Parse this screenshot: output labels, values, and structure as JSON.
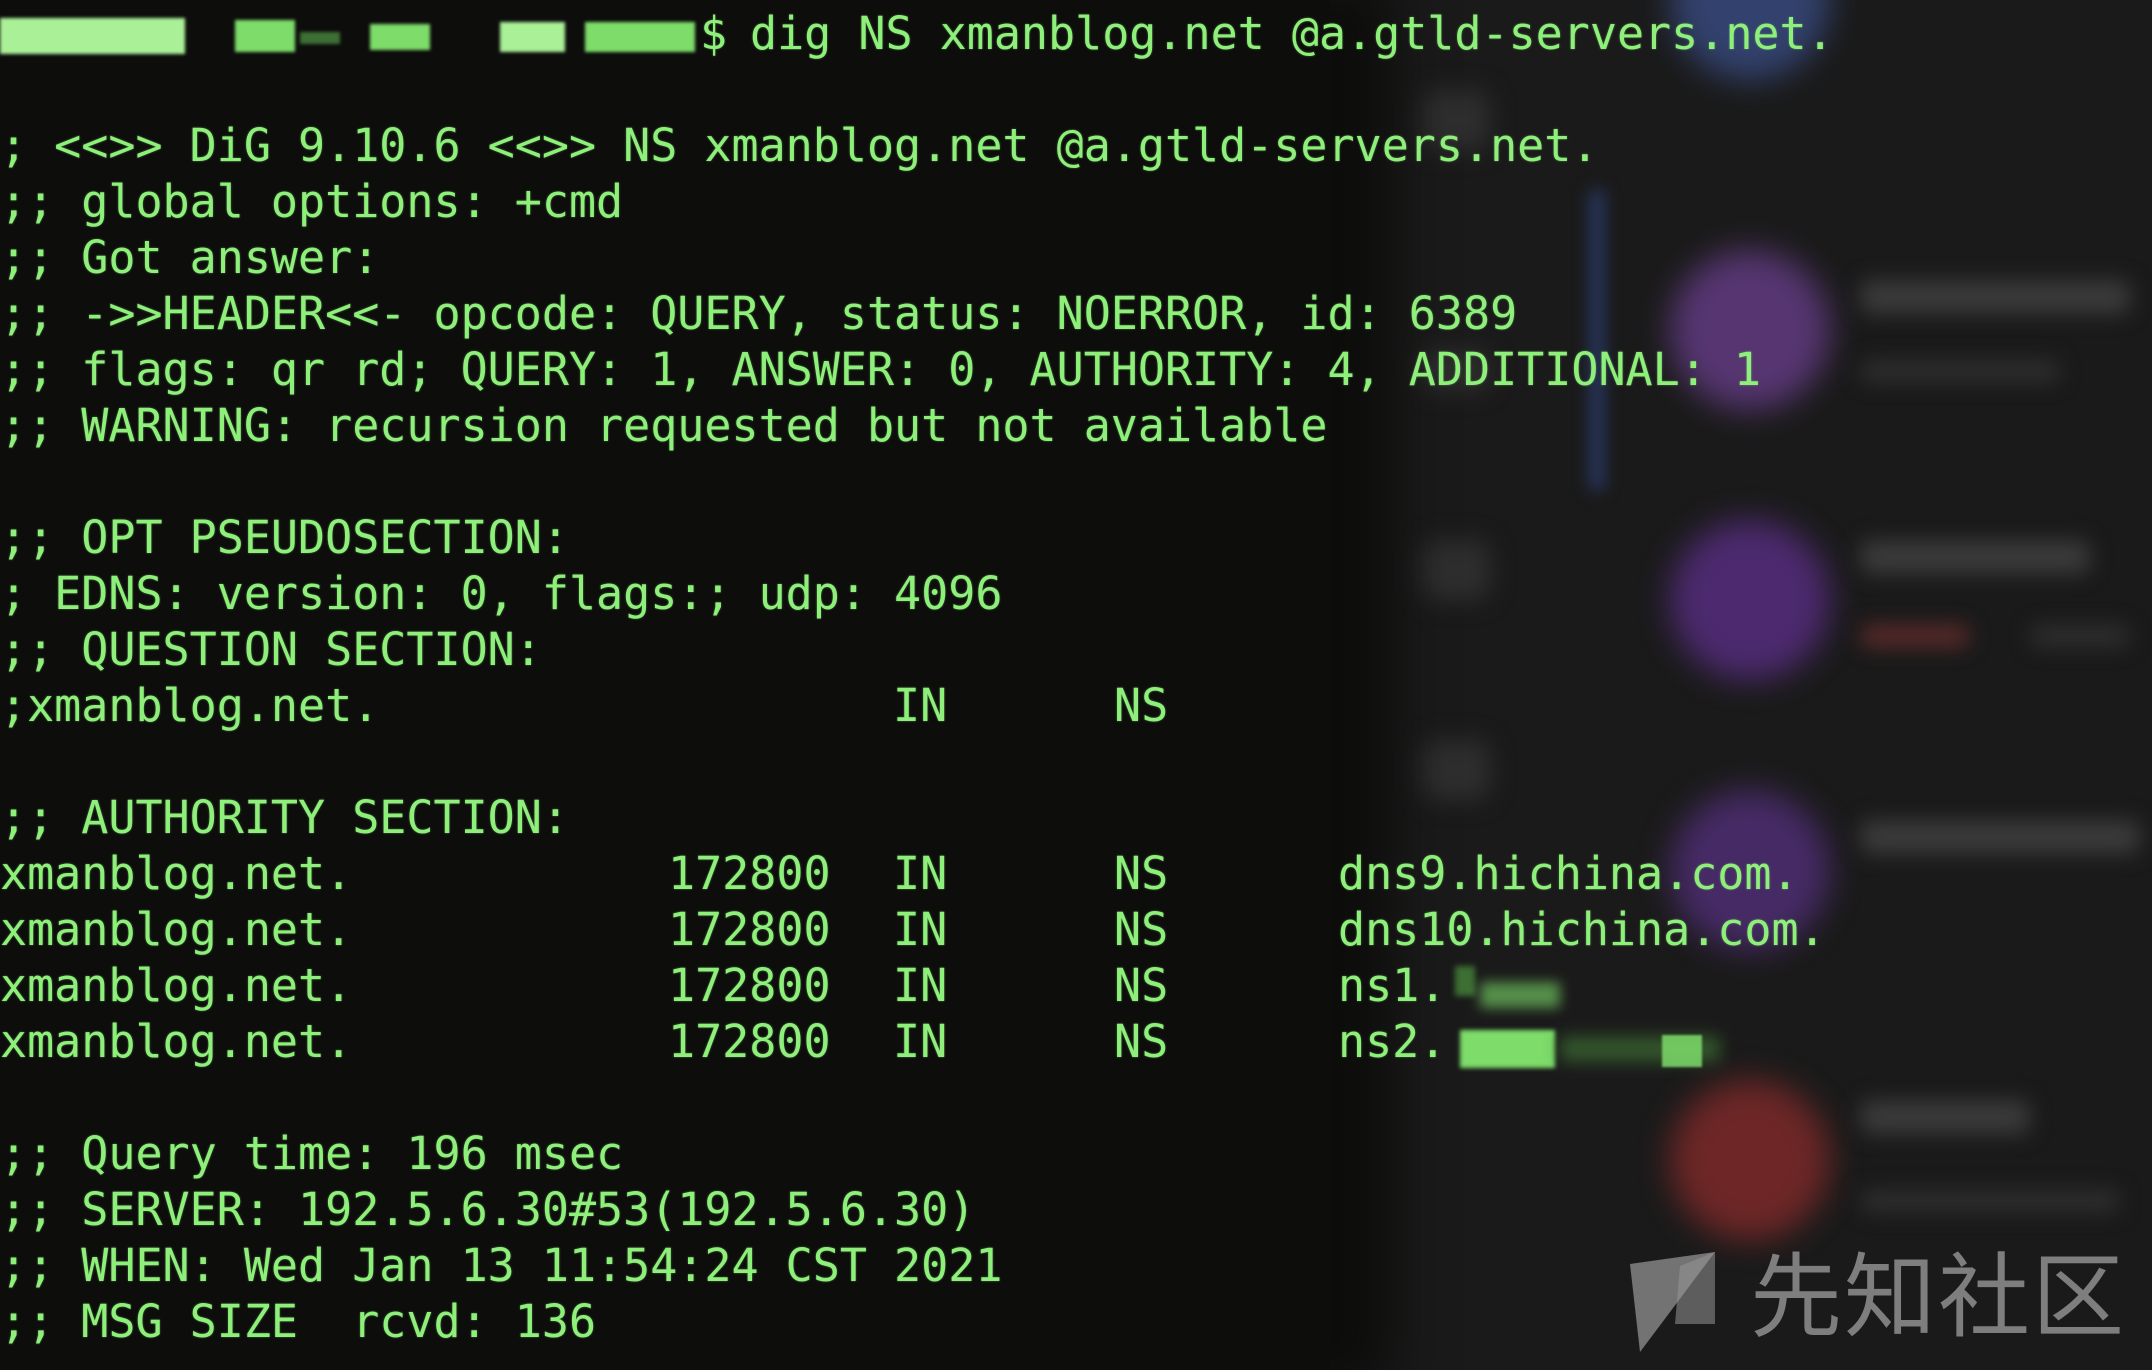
{
  "prompt": {
    "command": "dig NS xmanblog.net @a.gtld-servers.net."
  },
  "output": {
    "banner": "; <<>> DiG 9.10.6 <<>> NS xmanblog.net @a.gtld-servers.net.",
    "global_options": ";; global options: +cmd",
    "got_answer": ";; Got answer:",
    "header": ";; ->>HEADER<<- opcode: QUERY, status: NOERROR, id: 6389",
    "flags": ";; flags: qr rd; QUERY: 1, ANSWER: 0, AUTHORITY: 4, ADDITIONAL: 1",
    "warning": ";; WARNING: recursion requested but not available",
    "opt_title": ";; OPT PSEUDOSECTION:",
    "edns": "; EDNS: version: 0, flags:; udp: 4096",
    "question_title": ";; QUESTION SECTION:",
    "question": {
      "name": ";xmanblog.net.",
      "class": "IN",
      "type": "NS"
    },
    "authority_title": ";; AUTHORITY SECTION:",
    "authority": [
      {
        "name": "xmanblog.net.",
        "ttl": "172800",
        "class": "IN",
        "type": "NS",
        "value": "dns9.hichina.com."
      },
      {
        "name": "xmanblog.net.",
        "ttl": "172800",
        "class": "IN",
        "type": "NS",
        "value": "dns10.hichina.com."
      },
      {
        "name": "xmanblog.net.",
        "ttl": "172800",
        "class": "IN",
        "type": "NS",
        "value": "ns1."
      },
      {
        "name": "xmanblog.net.",
        "ttl": "172800",
        "class": "IN",
        "type": "NS",
        "value": "ns2."
      }
    ],
    "query_time": ";; Query time: 196 msec",
    "server": ";; SERVER: 192.5.6.30#53(192.5.6.30)",
    "when": ";; WHEN: Wed Jan 13 11:54:24 CST 2021",
    "msg_size": ";; MSG SIZE  rcvd: 136"
  },
  "watermark": {
    "text": "先知社区"
  },
  "colors": {
    "terminal_bg": "#0d0d0c",
    "terminal_fg": "#8ef07a",
    "background_app": "#1a1a1a"
  }
}
